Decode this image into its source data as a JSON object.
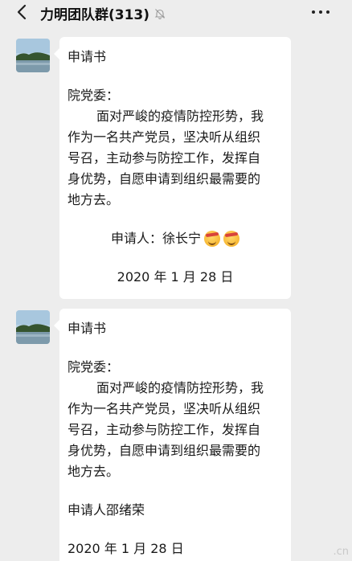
{
  "header": {
    "title": "力明团队群(313)"
  },
  "messages": [
    {
      "title": "申请书",
      "salutation": "院党委：",
      "body_lines": [
        "面对严峻的疫情防控形势，我",
        "作为一名共产党员，坚决听从组织",
        "号召，主动参与防控工作，发挥自",
        "身优势，自愿申请到组织最需要的",
        "地方去。"
      ],
      "signer": "申请人：徐长宁",
      "date": "2020 年 1 月 28 日"
    },
    {
      "title": "申请书",
      "salutation": "院党委：",
      "body_lines": [
        "面对严峻的疫情防控形势，我",
        "作为一名共产党员，坚决听从组织",
        "号召，主动参与防控工作，发挥自",
        "身优势，自愿申请到组织最需要的",
        "地方去。"
      ],
      "signer": "申请人邵绪荣",
      "date": "2020 年 1 月 28 日"
    }
  ],
  "watermark": ".cn",
  "icons": {
    "back": "chevron-left-icon",
    "mute": "bell-mute-icon",
    "more": "more-dots-icon",
    "emoji": "angry-face-emoji"
  }
}
